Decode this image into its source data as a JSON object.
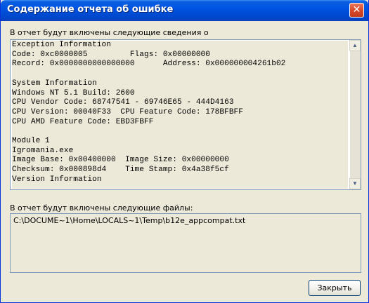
{
  "window": {
    "title": "Содержание отчета об ошибке",
    "close_glyph": "✕"
  },
  "report": {
    "label": "В отчет будут включены следующие сведения о",
    "lines": [
      "Exception Information",
      "Code: 0xc0000005         Flags: 0x00000000",
      "Record: 0x0000000000000000      Address: 0x000000004261b02",
      "",
      "System Information",
      "Windows NT 5.1 Build: 2600",
      "CPU Vendor Code: 68747541 - 69746E65 - 444D4163",
      "CPU Version: 00040F33  CPU Feature Code: 178BFBFF",
      "CPU AMD Feature Code: EBD3FBFF",
      "",
      "Module 1",
      "Igromania.exe",
      "Image Base: 0x00400000  Image Size: 0x00000000",
      "Checksum: 0x000898d4    Time Stamp: 0x4a38f5cf",
      "Version Information"
    ],
    "scroll_up_icon": "▲",
    "scroll_down_icon": "▼"
  },
  "files": {
    "label": "В отчет будут включены следующие файлы:",
    "items": [
      "C:\\DOCUME~1\\Home\\LOCALS~1\\Temp\\b12e_appcompat.txt"
    ]
  },
  "buttons": {
    "close_label": "Закрыть"
  }
}
